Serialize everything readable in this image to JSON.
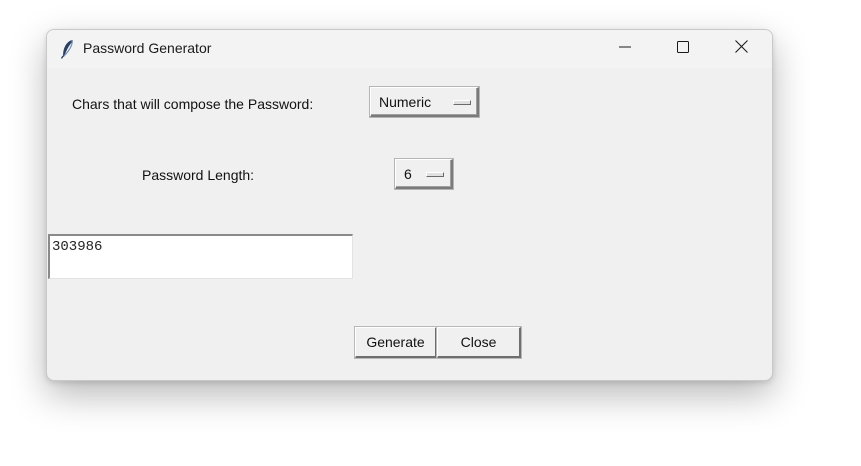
{
  "window": {
    "title": "Password Generator",
    "icon": "feather-icon",
    "controls": [
      "minimize-icon",
      "maximize-icon",
      "close-icon"
    ]
  },
  "chars_row": {
    "label": "Chars that will compose the Password:",
    "selected": "Numeric"
  },
  "length_row": {
    "label": "Password Length:",
    "selected": "6"
  },
  "output": {
    "value": "303986"
  },
  "buttons": {
    "generate": "Generate",
    "close": "Close"
  }
}
